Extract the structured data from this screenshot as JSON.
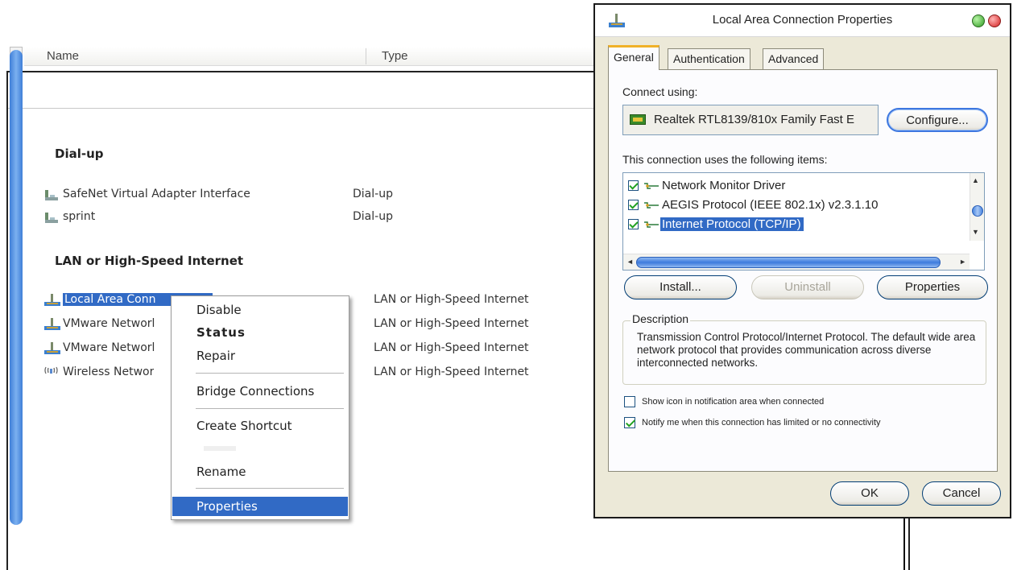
{
  "explorer": {
    "columns": [
      "Name",
      "Type"
    ],
    "groups": [
      {
        "title": "Dial-up",
        "rows": [
          {
            "name": "SafeNet Virtual Adapter Interface",
            "type": "Dial-up",
            "icon": "dialup-connection-icon"
          },
          {
            "name": "sprint",
            "type": "Dial-up",
            "icon": "dialup-connection-icon"
          }
        ]
      },
      {
        "title": "LAN or High-Speed Internet",
        "rows": [
          {
            "name": "Local Area Conn",
            "type": "LAN or High-Speed Internet",
            "icon": "lan-connection-icon",
            "selected": true
          },
          {
            "name": "VMware Networl",
            "type": "LAN or High-Speed Internet",
            "icon": "lan-connection-icon"
          },
          {
            "name": "VMware Networl",
            "type": "LAN or High-Speed Internet",
            "icon": "lan-connection-icon"
          },
          {
            "name": "Wireless Networ",
            "type": "LAN or High-Speed Internet",
            "icon": "wireless-connection-icon"
          }
        ]
      }
    ]
  },
  "context_menu": {
    "items": [
      "Disable",
      "Status",
      "Repair",
      "Bridge Connections",
      "Create Shortcut",
      "Rename",
      "Properties"
    ],
    "highlighted": "Properties"
  },
  "dialog": {
    "title": "Local Area Connection Properties",
    "tabs": [
      "General",
      "Authentication",
      "Advanced"
    ],
    "active_tab": "General",
    "connect_using_label": "Connect using:",
    "adapter": "Realtek RTL8139/810x Family Fast E",
    "configure_button": "Configure...",
    "items_label": "This connection uses the following items:",
    "items": [
      {
        "label": "Network Monitor Driver",
        "checked": true
      },
      {
        "label": "AEGIS Protocol (IEEE 802.1x) v2.3.1.10",
        "checked": true
      },
      {
        "label": "Internet Protocol (TCP/IP)",
        "checked": true,
        "selected": true
      }
    ],
    "install_button": "Install...",
    "uninstall_button": "Uninstall",
    "properties_button": "Properties",
    "description_legend": "Description",
    "description": "Transmission Control Protocol/Internet Protocol. The default wide area network protocol that provides communication across diverse interconnected networks.",
    "show_icon_label": "Show icon in notification area when connected",
    "show_icon_checked": false,
    "notify_label": "Notify me when this connection has limited or no connectivity",
    "notify_checked": true,
    "ok_button": "OK",
    "cancel_button": "Cancel"
  },
  "colors": {
    "selection": "#316ac5",
    "dialog_face": "#ece9d8",
    "tab_accent": "#f0b128",
    "scrollbar": "#3f7fd8"
  }
}
